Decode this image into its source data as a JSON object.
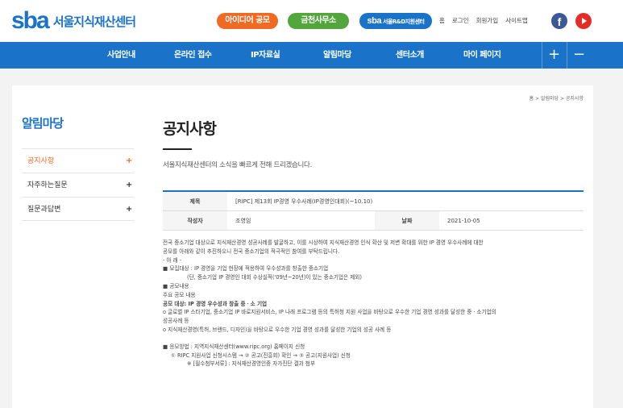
{
  "header": {
    "logo_mark": "sba",
    "logo_text": "서울지식재산센터",
    "pills": [
      {
        "label": "아이디어 공모"
      },
      {
        "label": "금천사무소"
      },
      {
        "label_mark": "sba",
        "label": "서울R&D지원센터"
      }
    ],
    "toplinks": [
      "홈",
      "로그인",
      "회원가입",
      "사이트맵"
    ],
    "social": [
      "facebook-icon",
      "youtube-icon"
    ],
    "colors": {
      "brand": "#1a73c8",
      "idea": "#f06a23",
      "office": "#52a63c"
    }
  },
  "gnb": {
    "items": [
      "사업안내",
      "온라인 접수",
      "IP자료실",
      "알림마당",
      "센터소개",
      "마이 페이지"
    ],
    "plus": "+",
    "minus": "−"
  },
  "breadcrumb": "홈 > 알림마당 > 공지사항",
  "lnb": {
    "title": "알림마당",
    "items": [
      {
        "label": "공지사항",
        "active": true
      },
      {
        "label": "자주하는질문",
        "active": false
      },
      {
        "label": "질문과답변",
        "active": false
      }
    ],
    "plus": "+"
  },
  "page": {
    "title": "공지사항",
    "subtitle": "서울지식재산센터의 소식을 빠르게 전해 드리겠습니다."
  },
  "board": {
    "title_label": "제목",
    "title_value": "[RIPC] 제13회 IP경영 우수사례(IP경영인대회)(~10.10)",
    "author_label": "작성자",
    "author_value": "조영임",
    "date_label": "날짜",
    "date_value": "2021-10-05",
    "content": [
      "전국 중소기업 대상으로 지식재산경영 성공사례를 발굴하고, 이를 시상하여 지식재산경영 인식 확산 및 저변 확대를 위한 IP 경영 우수사례에 대한",
      "공모를 아래와 같이 추진하오니 전국 중소기업의 적극적인 참여를 부탁드립니다.",
      "- 아          래 -",
      "■ 모집대상 : IP 경영을 기업 현장에 적용하여 우수성과를 창출한 중소기업",
      "(단, 중소기업 IP 경영인 대회 수상실적('09년~20년)이 있는 중소기업은 제외)",
      "■ 공모내용",
      "주요 공모 내용",
      "공모 대상: IP 경영 우수성과 창출 중ㆍ소 기업",
      "o 글로벌 IP 스타기업, 중소기업 IP 바로지원서비스, IP 나래 프로그램 등의 특허청 지원 사업을 바탕으로 우수한 기업 경영 성과를 달성한 중ㆍ소기업의",
      "성공사례 등",
      "o 지식재산경영(특허, 브랜드, 디자인)을 바탕으로 우수한 기업 경영 성과를 달성한 기업의 성공 사례 등",
      "■ 응모방법 : 지역지식재산센터(www.ripc.org) 홈페이지 신청",
      "① RIPC 지원사업 신청시스템 → ② 공고(진흥회) 확인 → ③ 공고(지원사업) 신청",
      "※ [필수첨부서류] : 지식재산경영인증 자가진단 결과 첨부"
    ]
  }
}
